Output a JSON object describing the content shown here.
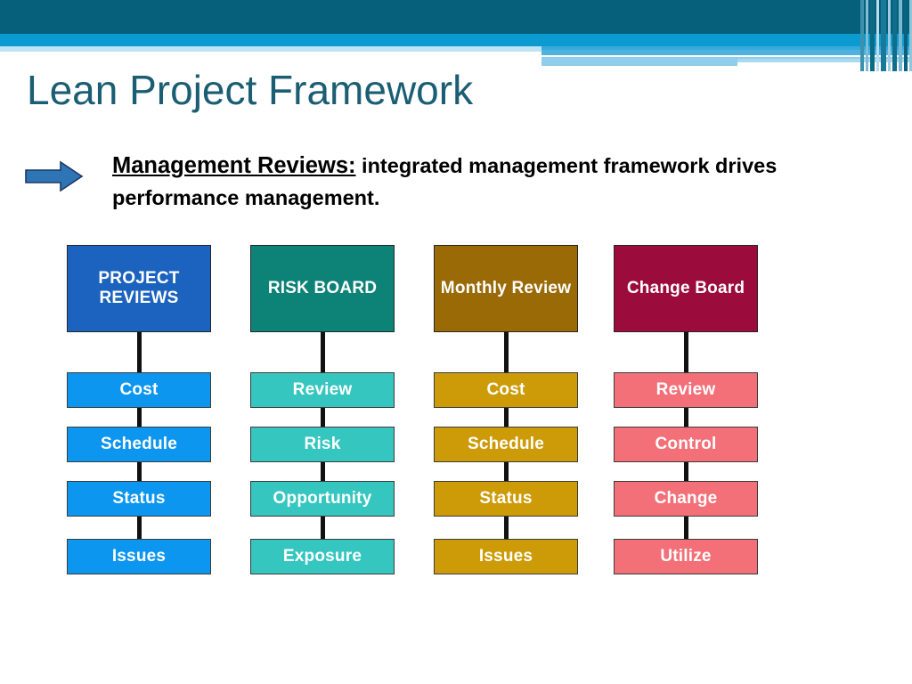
{
  "slide": {
    "title": "Lean Project Framework",
    "bullet": {
      "arrow_icon": "right-arrow-icon",
      "lead": "Management Reviews:",
      "body": "  integrated management framework drives performance management."
    }
  },
  "theme": {
    "banner_dark": "#07607B",
    "banner_mid": "#0C9BD0",
    "banner_pale": "#8FCEEA",
    "title_color": "#1B5E73",
    "arrow_fill": "#2E75B6",
    "arrow_stroke": "#1F3864",
    "connector": "#111111",
    "background": "#FFFFFF"
  },
  "chart_data": {
    "type": "diagram",
    "title": "Lean Project Framework",
    "layout": "four parallel vertical chains, each a header board with four linked review topics",
    "columns": [
      {
        "header": "PROJECT REVIEWS",
        "header_color": "#1B63BE",
        "item_color": "#0D96F0",
        "items": [
          "Cost",
          "Schedule",
          "Status",
          "Issues"
        ]
      },
      {
        "header": "RISK BOARD",
        "header_color": "#0D8276",
        "item_color": "#36C6C0",
        "items": [
          "Review",
          "Risk",
          "Opportunity",
          "Exposure"
        ]
      },
      {
        "header": "Monthly Review",
        "header_color": "#9A6A06",
        "item_color": "#CE9B08",
        "items": [
          "Cost",
          "Schedule",
          "Status",
          "Issues"
        ]
      },
      {
        "header": "Change Board",
        "header_color": "#9B0B3C",
        "item_color": "#F47078",
        "items": [
          "Review",
          "Control",
          "Change",
          "Utilize"
        ]
      }
    ]
  }
}
